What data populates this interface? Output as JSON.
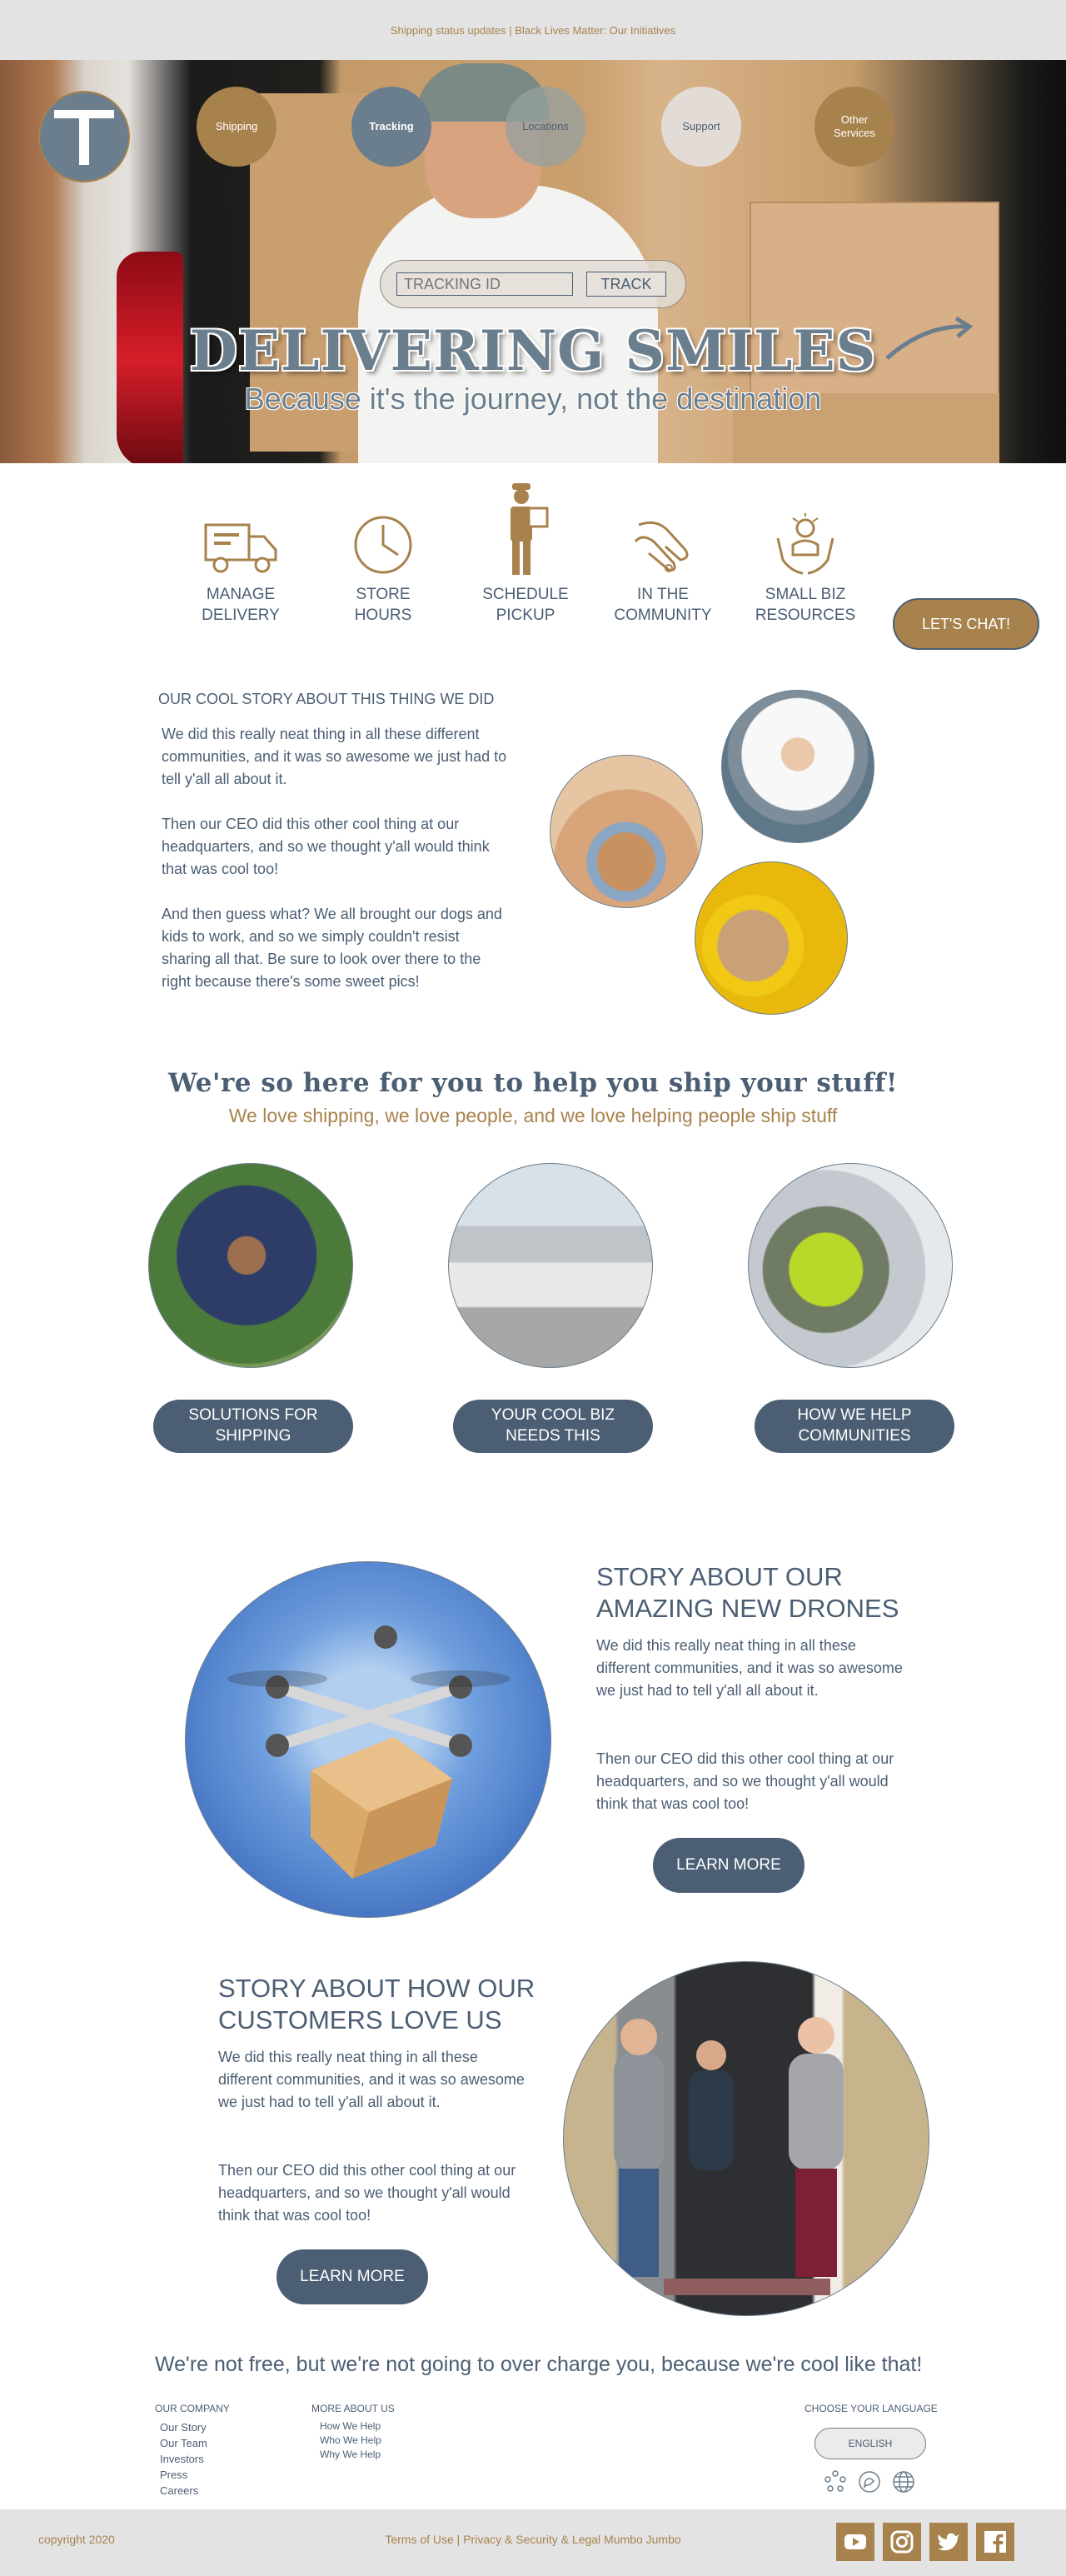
{
  "top_bar": {
    "text": "Shipping status updates | Black Lives Matter: Our Initiatives"
  },
  "logo": {
    "letter": "T"
  },
  "nav": [
    {
      "label": "Shipping"
    },
    {
      "label": "Tracking"
    },
    {
      "label": "Locations"
    },
    {
      "label": "Support"
    },
    {
      "label": "Other Services"
    }
  ],
  "tracking": {
    "placeholder": "TRACKING ID",
    "button_label": "TRACK"
  },
  "hero": {
    "title": "DELIVERING SMILES",
    "subtitle": "Because it's the journey, not the destination"
  },
  "quick_links": [
    {
      "label": "MANAGE DELIVERY",
      "icon": "truck-icon"
    },
    {
      "label": "STORE HOURS",
      "icon": "clock-icon"
    },
    {
      "label": "SCHEDULE PICKUP",
      "icon": "courier-icon"
    },
    {
      "label": "IN THE COMMUNITY",
      "icon": "handshake-icon"
    },
    {
      "label": "SMALL BIZ RESOURCES",
      "icon": "resources-icon"
    }
  ],
  "chat": {
    "label": "LET'S CHAT!"
  },
  "story": {
    "heading": "OUR COOL STORY ABOUT THIS THING WE DID",
    "paragraphs": [
      "We did this really neat thing in all these different communities, and it was so awesome we just had to tell y'all all about it.",
      "Then our CEO did this other cool thing at our headquarters, and so we thought y'all would think that was cool too!",
      "And then guess what? We all brought our dogs and kids to work, and so we simply couldn't resist sharing all that. Be sure to look over there to the right because there's some sweet pics!"
    ]
  },
  "tagline": {
    "heading": "We're so here for you to help you ship your stuff!",
    "subheading": "We love shipping, we love people, and we love helping people ship stuff"
  },
  "services": [
    {
      "label": "SOLUTIONS FOR SHIPPING"
    },
    {
      "label": "YOUR COOL BIZ NEEDS THIS"
    },
    {
      "label": "HOW WE HELP COMMUNITIES"
    }
  ],
  "drones": {
    "heading": "STORY ABOUT OUR AMAZING NEW DRONES",
    "paragraphs": [
      "We did this really neat thing in all these different communities, and it was so awesome we just had to tell y'all all about it.",
      "Then our CEO did this other cool thing at our headquarters, and so we thought y'all would think that was cool too!"
    ],
    "button": "LEARN MORE"
  },
  "customers": {
    "heading": "STORY ABOUT HOW OUR CUSTOMERS LOVE US",
    "paragraphs": [
      "We did this really neat thing in all these different communities, and it was so awesome we just had to tell y'all all about it.",
      "Then our CEO did this other cool thing at our headquarters, and so we thought y'all would think that was cool too!"
    ],
    "button": "LEARN MORE"
  },
  "pricing_line": "We're not free, but we're not going to over charge you, because we're cool like that!",
  "footer": {
    "company_title": "OUR COMPANY",
    "company_links": [
      "Our Story",
      "Our Team",
      "Investors",
      "Press",
      "Careers"
    ],
    "more_title": "MORE ABOUT US",
    "more_links": [
      "How We Help",
      "Who We Help",
      "Why We Help"
    ],
    "language_title": "CHOOSE YOUR LANGUAGE",
    "language_button": "ENGLISH",
    "copyright": "copyright 2020",
    "legal": "Terms of Use | Privacy & Security & Legal Mumbo Jumbo",
    "social": [
      "youtube-icon",
      "instagram-icon",
      "twitter-icon",
      "facebook-icon"
    ]
  },
  "colors": {
    "accent": "#a8824d",
    "primary": "#4b5e73",
    "light": "#e3e3e3"
  }
}
